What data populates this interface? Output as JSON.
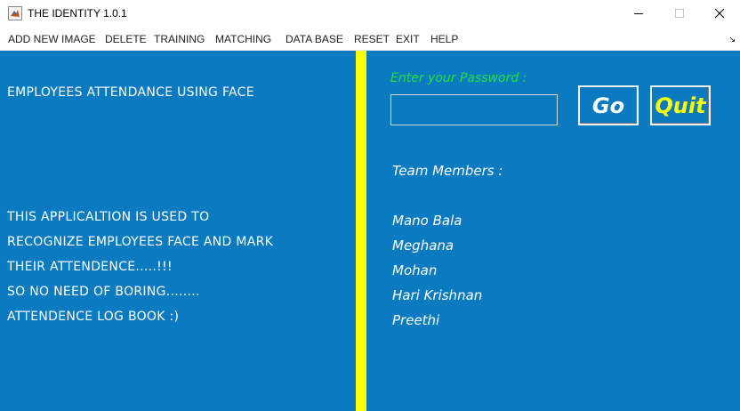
{
  "window": {
    "title": "THE IDENTITY 1.0.1",
    "app_icon": "matlab-icon",
    "controls": [
      "minimize-icon",
      "maximize-icon",
      "close-icon"
    ]
  },
  "menu": {
    "items": [
      {
        "label": "ADD NEW IMAGE"
      },
      {
        "label": "DELETE"
      },
      {
        "label": "TRAINING"
      },
      {
        "label": "MATCHING"
      },
      {
        "label": "DATA BASE"
      },
      {
        "label": "RESET"
      },
      {
        "label": "EXIT"
      },
      {
        "label": "HELP"
      }
    ],
    "corner_arrow": "↘"
  },
  "left": {
    "heading": "EMPLOYEES ATTENDANCE USING FACE",
    "lines": [
      "THIS  APPLICALTION IS USED TO",
      "RECOGNIZE EMPLOYEES FACE AND MARK",
      "THEIR ATTENDENCE.....!!!",
      "SO NO  NEED OF BORING........",
      "ATTENDENCE LOG BOOK :)"
    ]
  },
  "right": {
    "password_label": "Enter your Password :",
    "password_value": "",
    "go_label": "Go",
    "quit_label": "Quit",
    "team_label": "Team Members :",
    "members": [
      "Mano Bala",
      "Meghana",
      "Mohan",
      "Hari Krishnan",
      "Preethi"
    ]
  },
  "colors": {
    "panel_bg": "#0b7bc1",
    "divider": "#ffff00",
    "password_label": "#22e03a",
    "quit_text": "#ffff00",
    "text": "#ffffff"
  }
}
